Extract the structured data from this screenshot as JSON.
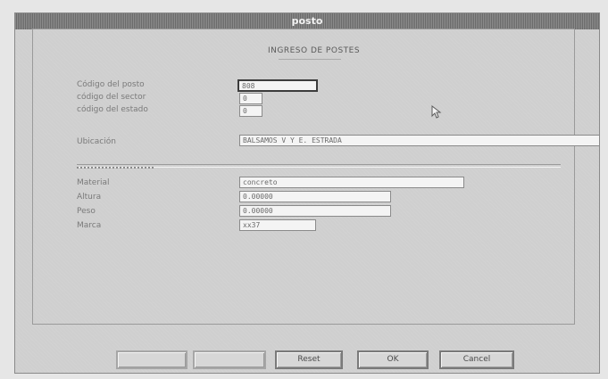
{
  "window": {
    "title": "posto"
  },
  "panel": {
    "title": "INGRESO DE POSTES"
  },
  "fields": {
    "codigo_posto": {
      "label": "Código del posto",
      "value": "808"
    },
    "codigo_sector": {
      "label": "código del sector",
      "value": "0"
    },
    "codigo_estado": {
      "label": "código del estado",
      "value": "0"
    },
    "ubicacion": {
      "label": "Ubicación",
      "value": "BALSAMOS V Y E. ESTRADA"
    },
    "material": {
      "label": "Material",
      "value": "concreto"
    },
    "altura": {
      "label": "Altura",
      "value": "0.00000"
    },
    "peso": {
      "label": "Peso",
      "value": "0.00000"
    },
    "marca": {
      "label": "Marca",
      "value": "xx37"
    }
  },
  "buttons": {
    "b1": {
      "label": ""
    },
    "b2": {
      "label": ""
    },
    "reset": {
      "label": "Reset"
    },
    "ok": {
      "label": "OK"
    },
    "cancel": {
      "label": "Cancel"
    }
  },
  "icons": {
    "cursor": "mouse-pointer-icon"
  }
}
